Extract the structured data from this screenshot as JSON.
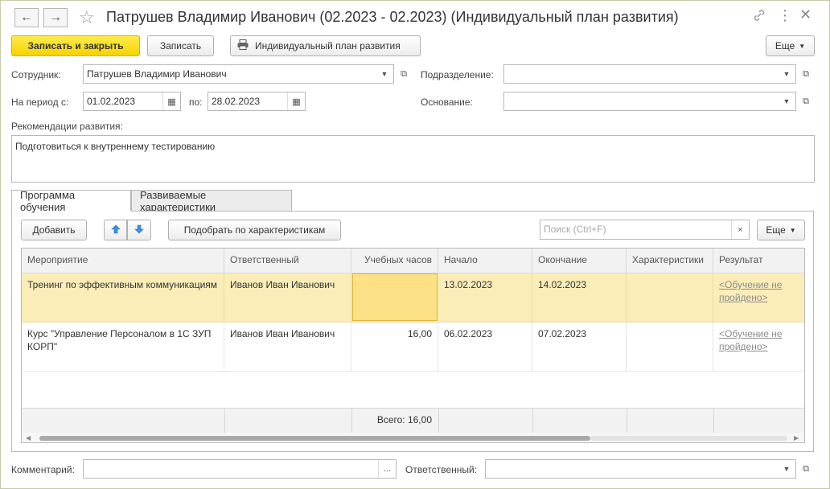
{
  "window": {
    "title": "Патрушев Владимир Иванович (02.2023 - 02.2023) (Индивидуальный план развития)"
  },
  "toolbar": {
    "save_close": "Записать и закрыть",
    "save": "Записать",
    "print_plan": "Индивидуальный план развития",
    "more": "Еще"
  },
  "form": {
    "employee_label": "Сотрудник:",
    "employee_value": "Патрушев Владимир Иванович",
    "department_label": "Подразделение:",
    "department_value": "",
    "period_from_label": "На период с:",
    "period_from_value": "01.02.2023",
    "period_to_label": "по:",
    "period_to_value": "28.02.2023",
    "basis_label": "Основание:",
    "basis_value": "",
    "recommendations_label": "Рекомендации развития:",
    "recommendations_value": "Подготовиться к внутреннему тестированию",
    "comment_label": "Комментарий:",
    "comment_value": "",
    "responsible_label": "Ответственный:",
    "responsible_value": ""
  },
  "tabs": [
    {
      "label": "Программа обучения"
    },
    {
      "label": "Развиваемые характеристики"
    }
  ],
  "tab_toolbar": {
    "add": "Добавить",
    "pick": "Подобрать по характеристикам",
    "search_placeholder": "Поиск (Ctrl+F)",
    "more": "Еще"
  },
  "table": {
    "columns": [
      "Мероприятие",
      "Ответственный",
      "Учебных часов",
      "Начало",
      "Окончание",
      "Характеристики",
      "Результат"
    ],
    "rows": [
      {
        "event": "Тренинг по эффективным коммуникациям",
        "responsible": "Иванов Иван Иванович",
        "hours": "",
        "start": "13.02.2023",
        "end": "14.02.2023",
        "chars": "",
        "result": "<Обучение не пройдено>"
      },
      {
        "event": "Курс \"Управление Персоналом в 1С ЗУП КОРП\"",
        "responsible": "Иванов Иван Иванович",
        "hours": "16,00",
        "start": "06.02.2023",
        "end": "07.02.2023",
        "chars": "",
        "result": "<Обучение не пройдено>"
      }
    ],
    "total": "Всего: 16,00"
  }
}
